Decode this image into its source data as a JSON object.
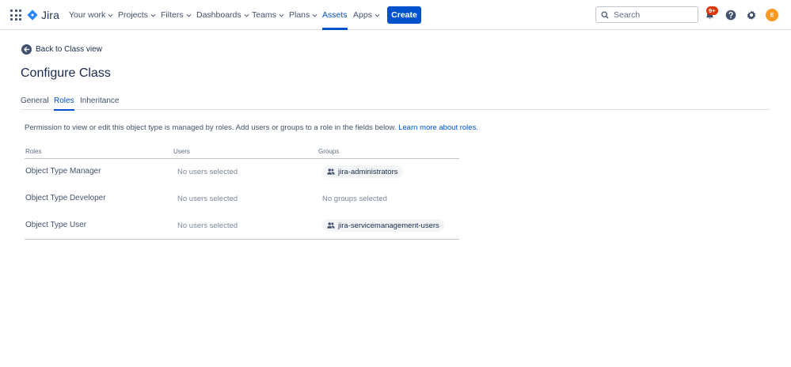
{
  "nav": {
    "logo_text": "Jira",
    "items": [
      {
        "label": "Your work",
        "dropdown": true
      },
      {
        "label": "Projects",
        "dropdown": true
      },
      {
        "label": "Filters",
        "dropdown": true
      },
      {
        "label": "Dashboards",
        "dropdown": true
      },
      {
        "label": "Teams",
        "dropdown": true
      },
      {
        "label": "Plans",
        "dropdown": true
      },
      {
        "label": "Assets",
        "dropdown": false,
        "active": true
      },
      {
        "label": "Apps",
        "dropdown": true
      }
    ],
    "create_label": "Create",
    "search_placeholder": "Search",
    "notifications_badge": "9+",
    "avatar_initial": "E"
  },
  "page": {
    "back_label": "Back to Class view",
    "title": "Configure Class",
    "tabs": [
      {
        "label": "General",
        "active": false
      },
      {
        "label": "Roles",
        "active": true
      },
      {
        "label": "Inheritance",
        "active": false
      }
    ],
    "description": "Permission to view or edit this object type is managed by roles. Add users or groups to a role in the fields below.",
    "learn_more": "Learn more about roles."
  },
  "table": {
    "headers": [
      "Roles",
      "Users",
      "Groups"
    ],
    "rows": [
      {
        "role": "Object Type Manager",
        "users": "No users selected",
        "groups": "jira-administrators",
        "groups_is_chip": true
      },
      {
        "role": "Object Type Developer",
        "users": "No users selected",
        "groups": "No groups selected",
        "groups_is_chip": false
      },
      {
        "role": "Object Type User",
        "users": "No users selected",
        "groups": "jira-servicemanagement-users",
        "groups_is_chip": true
      }
    ]
  },
  "colors": {
    "accent": "#0052cc",
    "badge": "#de350b",
    "avatar": "#ff991f"
  },
  "icons": [
    "app-switcher-icon",
    "jira-logo-icon",
    "chevron-down-icon",
    "search-icon",
    "notifications-icon",
    "help-icon",
    "settings-icon",
    "arrow-left-icon",
    "people-icon"
  ]
}
